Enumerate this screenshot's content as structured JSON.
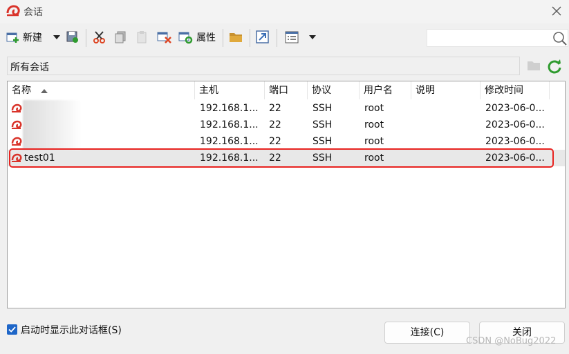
{
  "window": {
    "title": "会话"
  },
  "toolbar": {
    "new_label": "新建",
    "properties_label": "属性"
  },
  "search": {
    "placeholder": ""
  },
  "path": {
    "text": "所有会话"
  },
  "columns": [
    "名称",
    "主机",
    "端口",
    "协议",
    "用户名",
    "说明",
    "修改时间"
  ],
  "rows": [
    {
      "name": "",
      "host": "192.168.1...",
      "port": "22",
      "protocol": "SSH",
      "user": "root",
      "desc": "",
      "modified": "2023-06-0..."
    },
    {
      "name": "",
      "host": "192.168.1...",
      "port": "22",
      "protocol": "SSH",
      "user": "root",
      "desc": "",
      "modified": "2023-06-0..."
    },
    {
      "name": "",
      "host": "192.168.1...",
      "port": "22",
      "protocol": "SSH",
      "user": "root",
      "desc": "",
      "modified": "2023-06-0..."
    },
    {
      "name": "test01",
      "host": "192.168.1...",
      "port": "22",
      "protocol": "SSH",
      "user": "root",
      "desc": "",
      "modified": "2023-06-0..."
    }
  ],
  "footer": {
    "startup_checkbox_label": "启动时显示此对话框(S)",
    "startup_checked": true,
    "connect_label": "连接(C)",
    "close_label": "关闭"
  },
  "watermark": "CSDN @NoBug2022",
  "colors": {
    "accent": "#1e66c8",
    "highlight": "#e8211e",
    "brand": "#d9332a"
  }
}
